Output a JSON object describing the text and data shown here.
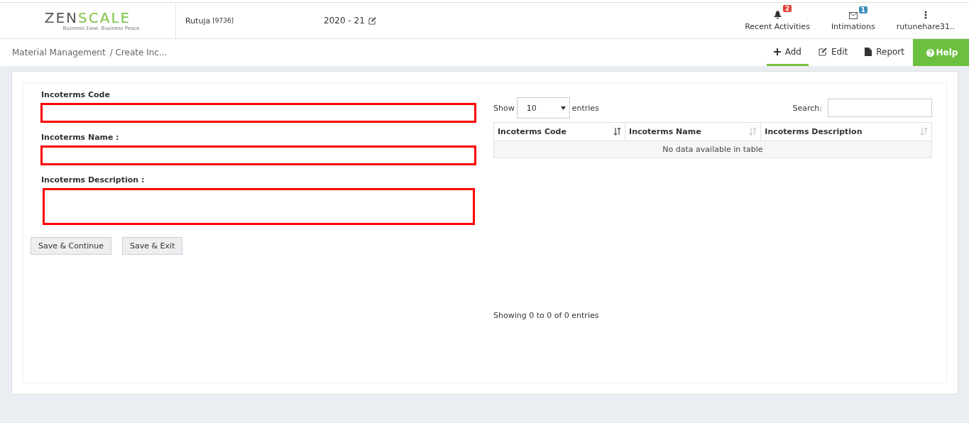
{
  "logo": {
    "dark": "ZEN",
    "accent": "SCALE",
    "tagline": "Business Ease. Business Peace."
  },
  "header": {
    "user": "Rutuja",
    "user_code": "[9736]",
    "year": "2020 - 21",
    "items": [
      {
        "kind": "bell",
        "label": "Recent Activities",
        "badge": "2",
        "color": "#e0413a"
      },
      {
        "kind": "mail",
        "label": "Intimations",
        "badge": "1",
        "color": "#3c8dbc"
      },
      {
        "kind": "dots",
        "label": "rutunehare31.."
      }
    ]
  },
  "breadcrumb": [
    "Material Management",
    "/ Create Inc..."
  ],
  "toolbar": [
    {
      "kind": "add",
      "label": "Add",
      "selected": true
    },
    {
      "kind": "edit",
      "label": "Edit",
      "selected": false
    },
    {
      "kind": "report",
      "label": "Report",
      "selected": false
    }
  ],
  "help": "Help",
  "form": {
    "fields": [
      {
        "kind": "input",
        "label": "Incoterms Code",
        "highlighted": true
      },
      {
        "kind": "input",
        "label": "Incoterms Name :",
        "highlighted": true
      },
      {
        "kind": "textarea",
        "label": "Incoterms Description :",
        "highlighted": true
      }
    ],
    "buttons": [
      "Save & Continue",
      "Save & Exit"
    ]
  },
  "table": {
    "show_label": "Show",
    "page_size": "10",
    "entries_label": "entries",
    "search_label": "Search:",
    "columns": [
      {
        "label": "Incoterms Code",
        "sorted": true
      },
      {
        "label": "Incoterms Name",
        "sorted": false
      },
      {
        "label": "Incoterms Description",
        "sorted": false
      }
    ],
    "empty": "No data available in table",
    "info": "Showing 0 to 0 of 0 entries"
  }
}
